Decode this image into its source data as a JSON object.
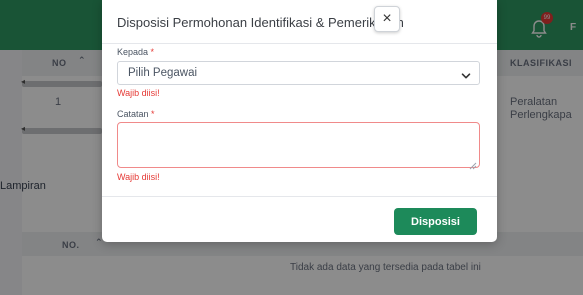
{
  "background": {
    "user_initial": "F",
    "notification_count": "99",
    "table1": {
      "col_no": "NO",
      "col_klasifikasi": "KLASIFIKASI",
      "row": {
        "no": "1",
        "klasifikasi_line1": "Peralatan",
        "klasifikasi_line2": "Perlengkapa"
      }
    },
    "lampiran": {
      "title": "Lampiran",
      "col_no": "NO.",
      "empty_text": "Tidak ada data yang tersedia pada tabel ini"
    }
  },
  "modal": {
    "title": "Disposisi Permohonan Identifikasi & Pemeriksaan",
    "close_label": "×",
    "kepada": {
      "label": "Kepada",
      "required_mark": "*",
      "selected": "Pilih Pegawai",
      "error": "Wajib diisi!"
    },
    "catatan": {
      "label": "Catatan",
      "required_mark": "*",
      "value": "",
      "error": "Wajib diisi!"
    },
    "submit_label": "Disposisi"
  },
  "colors": {
    "brand_green": "#2f9a63",
    "button_green": "#1d8a5a",
    "error_red": "#e53935"
  }
}
